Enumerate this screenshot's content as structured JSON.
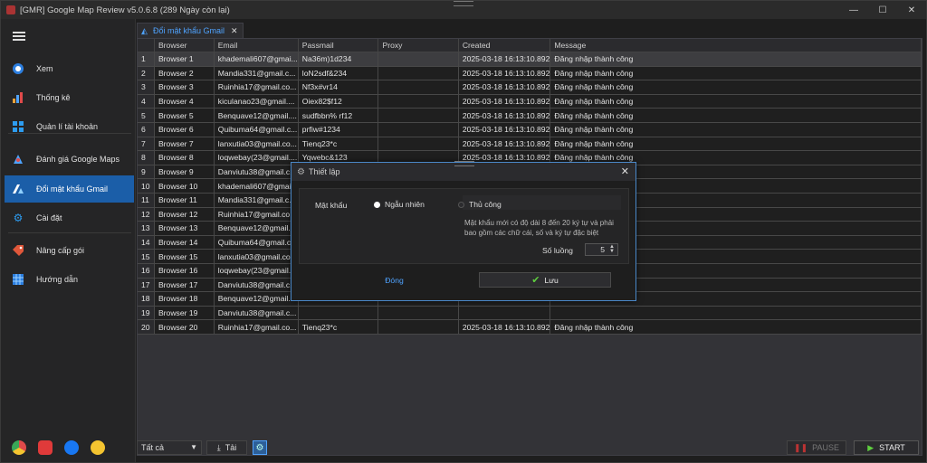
{
  "window": {
    "title": "[GMR] Google Map Review v5.0.6.8 (289 Ngày còn lại)"
  },
  "sidebar": {
    "items": [
      {
        "label": "Xem",
        "icon": "eye-icon"
      },
      {
        "label": "Thống kê",
        "icon": "chart-icon"
      },
      {
        "label": "Quản lí tài khoản",
        "icon": "windows-icon"
      },
      {
        "label": "Đánh giá Google Maps",
        "icon": "maps-icon"
      },
      {
        "label": "Đổi mật khẩu Gmail",
        "icon": "ads-icon",
        "active": true
      },
      {
        "label": "Cài đặt",
        "icon": "gear-icon"
      },
      {
        "label": "Nâng cấp gói",
        "icon": "tag-icon"
      },
      {
        "label": "Hướng dẫn",
        "icon": "grid-icon"
      }
    ]
  },
  "tab": {
    "label": "Đổi mật khẩu Gmail"
  },
  "grid": {
    "columns": [
      "Browser",
      "Email",
      "Passmail",
      "Proxy",
      "Created",
      "Message"
    ],
    "rows": [
      {
        "n": "1",
        "browser": "Browser 1",
        "email": "khademali607@gmai...",
        "pass": "Na36m)1d234",
        "proxy": "",
        "created": "2025-03-18 16:13:10.892",
        "message": "Đăng nhập thành công"
      },
      {
        "n": "2",
        "browser": "Browser 2",
        "email": "Mandia331@gmail.c...",
        "pass": "loN2sdf&234",
        "proxy": "",
        "created": "2025-03-18 16:13:10.892",
        "message": "Đăng nhập thành công"
      },
      {
        "n": "3",
        "browser": "Browser 3",
        "email": "Ruinhia17@gmail.co...",
        "pass": "Nf3x#vr14",
        "proxy": "",
        "created": "2025-03-18 16:13:10.892",
        "message": "Đăng nhập thành công"
      },
      {
        "n": "4",
        "browser": "Browser 4",
        "email": "kiculanao23@gmail....",
        "pass": "Oiex82$f12",
        "proxy": "",
        "created": "2025-03-18 16:13:10.892",
        "message": "Đăng nhập thành công"
      },
      {
        "n": "5",
        "browser": "Browser 5",
        "email": "Benquave12@gmail....",
        "pass": "sudfbbn% rf12",
        "proxy": "",
        "created": "2025-03-18 16:13:10.892",
        "message": "Đăng nhập thành công"
      },
      {
        "n": "6",
        "browser": "Browser 6",
        "email": "Quibuma64@gmail.c...",
        "pass": "prfiw#1234",
        "proxy": "",
        "created": "2025-03-18 16:13:10.892",
        "message": "Đăng nhập thành công"
      },
      {
        "n": "7",
        "browser": "Browser 7",
        "email": "lanxutia03@gmail.co...",
        "pass": "Tienq23*c",
        "proxy": "",
        "created": "2025-03-18 16:13:10.892",
        "message": "Đăng nhập thành công"
      },
      {
        "n": "8",
        "browser": "Browser 8",
        "email": "loqwebay(23@gmail....",
        "pass": "Yqwebc&123",
        "proxy": "",
        "created": "2025-03-18 16:13:10.892",
        "message": "Đăng nhập thành công"
      },
      {
        "n": "9",
        "browser": "Browser 9",
        "email": "Danviutu38@gmail.c...",
        "pass": "",
        "proxy": "",
        "created": "",
        "message": ""
      },
      {
        "n": "10",
        "browser": "Browser 10",
        "email": "khademali607@gmai...",
        "pass": "",
        "proxy": "",
        "created": "",
        "message": ""
      },
      {
        "n": "11",
        "browser": "Browser 11",
        "email": "Mandia331@gmail.c...",
        "pass": "",
        "proxy": "",
        "created": "",
        "message": ""
      },
      {
        "n": "12",
        "browser": "Browser 12",
        "email": "Ruinhia17@gmail.co...",
        "pass": "",
        "proxy": "",
        "created": "",
        "message": ""
      },
      {
        "n": "13",
        "browser": "Browser 13",
        "email": "Benquave12@gmail....",
        "pass": "",
        "proxy": "",
        "created": "",
        "message": ""
      },
      {
        "n": "14",
        "browser": "Browser 14",
        "email": "Quibuma64@gmail.c...",
        "pass": "",
        "proxy": "",
        "created": "",
        "message": ""
      },
      {
        "n": "15",
        "browser": "Browser 15",
        "email": "lanxutia03@gmail.co...",
        "pass": "",
        "proxy": "",
        "created": "",
        "message": ""
      },
      {
        "n": "16",
        "browser": "Browser 16",
        "email": "loqwebay(23@gmail....",
        "pass": "",
        "proxy": "",
        "created": "",
        "message": ""
      },
      {
        "n": "17",
        "browser": "Browser 17",
        "email": "Danviutu38@gmail.c...",
        "pass": "",
        "proxy": "",
        "created": "",
        "message": ""
      },
      {
        "n": "18",
        "browser": "Browser 18",
        "email": "Benquave12@gmail....",
        "pass": "",
        "proxy": "",
        "created": "",
        "message": ""
      },
      {
        "n": "19",
        "browser": "Browser 19",
        "email": "Danviutu38@gmail.c...",
        "pass": "",
        "proxy": "",
        "created": "",
        "message": ""
      },
      {
        "n": "20",
        "browser": "Browser 20",
        "email": "Ruinhia17@gmail.co...",
        "pass": "Tienq23*c",
        "proxy": "",
        "created": "2025-03-18 16:13:10.892",
        "message": "Đăng nhập thành công"
      }
    ]
  },
  "bottombar": {
    "filter_value": "Tất cả",
    "load_label": "Tải",
    "pause_label": "PAUSE",
    "start_label": "START"
  },
  "dialog": {
    "title": "Thiết lập",
    "password_label": "Mật khẩu",
    "random_label": "Ngẫu nhiên",
    "manual_label": "Thủ công",
    "hint": "Mật khẩu mới có độ dài 8 đến 20 ký tự và phải bao gồm các chữ cái, số và ký tự đặc biệt",
    "count_label": "Số luồng",
    "count_value": "5",
    "close_label": "Đóng",
    "save_label": "Lưu"
  },
  "colors": {
    "accent": "#1b5ea8",
    "link": "#4fa3ff"
  }
}
